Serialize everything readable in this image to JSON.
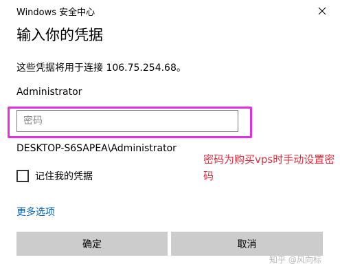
{
  "window": {
    "title": "Windows 安全中心",
    "close_icon": "close-icon"
  },
  "dialog": {
    "heading": "输入你的凭据",
    "subtitle": "这些凭据将用于连接 106.75.254.68。",
    "username": "Administrator",
    "password": {
      "value": "",
      "placeholder": "密码"
    },
    "domain_user": "DESKTOP-S6SAPEA\\Administrator",
    "remember_label": "记住我的凭据",
    "remember_checked": false,
    "more_options": "更多选项",
    "ok_label": "确定",
    "cancel_label": "取消"
  },
  "annotation": {
    "text": "密码为购买vps时手动设置密码",
    "color": "#e32b3b",
    "highlight_color": "#e12fe3"
  },
  "watermark": "知乎 @风向标",
  "colors": {
    "link": "#0063b1",
    "button_bg": "#cccccc"
  }
}
